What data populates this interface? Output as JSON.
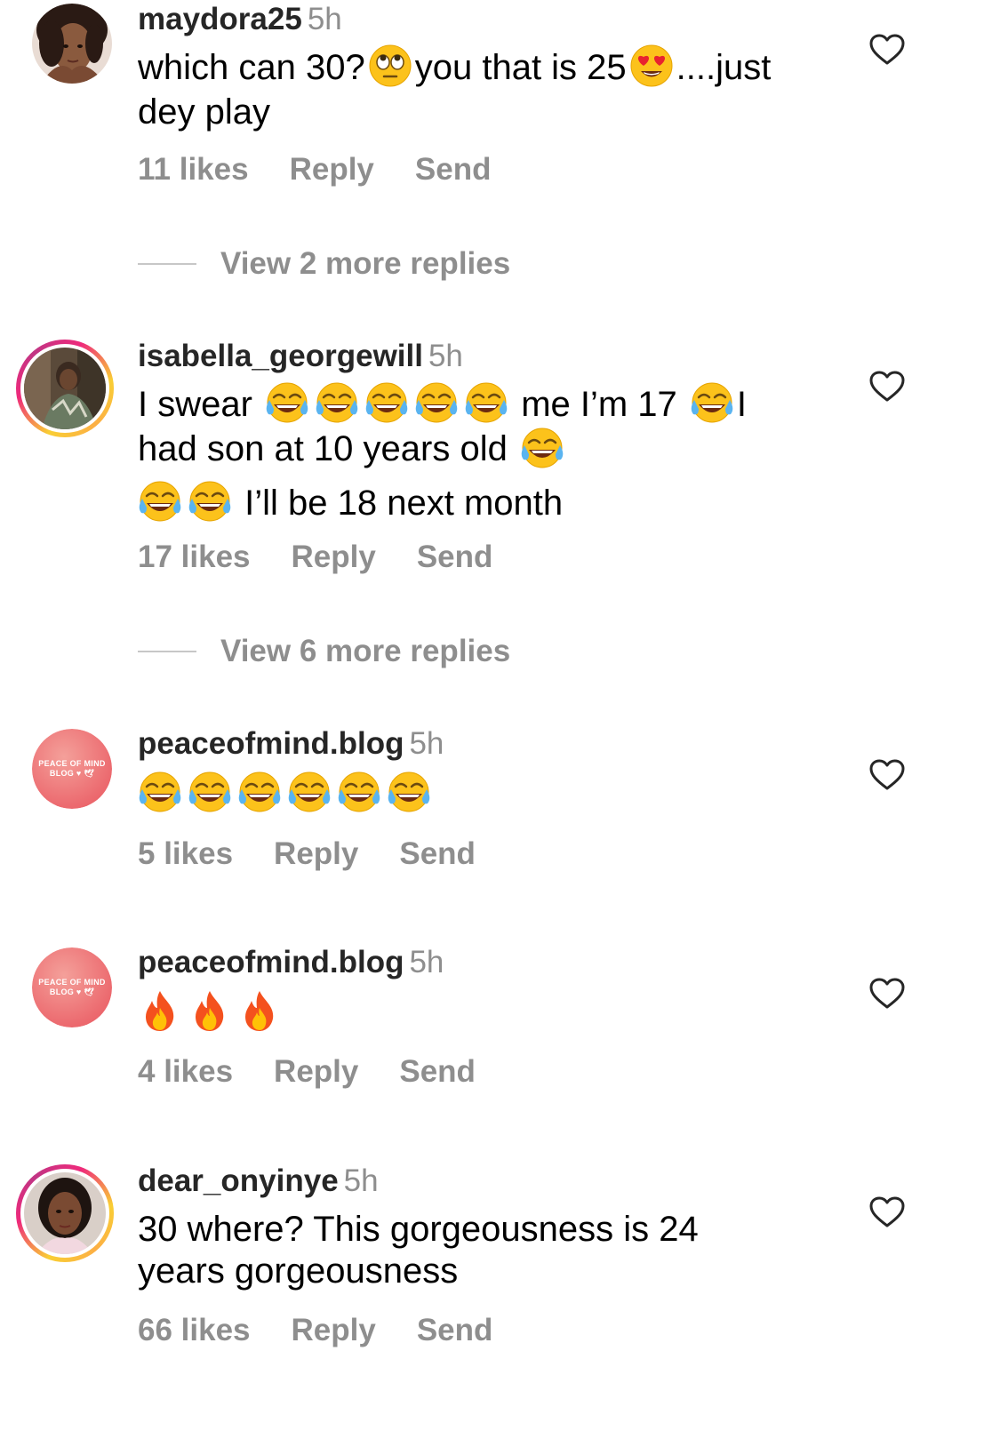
{
  "comments": [
    {
      "username": "maydora25",
      "time": "5h",
      "text_parts": [
        "which can 30?",
        "you that is 25",
        "....just",
        "dey play"
      ],
      "emojis": [
        "rolling-eyes-emoji",
        "heart-eyes-emoji"
      ],
      "likes": "11 likes",
      "reply": "Reply",
      "send": "Send",
      "view_replies": "View 2 more replies"
    },
    {
      "username": "isabella_georgewill",
      "time": "5h",
      "text_parts": [
        "I swear",
        "me I’m 17",
        "I",
        "had son at 10 years old",
        "I’ll be 18 next month"
      ],
      "emojis": [
        "tears-of-joy-emoji"
      ],
      "likes": "17 likes",
      "reply": "Reply",
      "send": "Send",
      "view_replies": "View 6 more replies"
    },
    {
      "username": "peaceofmind.blog",
      "time": "5h",
      "avatar_text": [
        "PEACE OF MIND",
        "BLOG ♥ 🕊"
      ],
      "emojis": [
        "tears-of-joy-emoji"
      ],
      "likes": "5 likes",
      "reply": "Reply",
      "send": "Send"
    },
    {
      "username": "peaceofmind.blog",
      "time": "5h",
      "avatar_text": [
        "PEACE OF MIND",
        "BLOG ♥ 🕊"
      ],
      "emojis": [
        "fire-emoji"
      ],
      "likes": "4 likes",
      "reply": "Reply",
      "send": "Send"
    },
    {
      "username": "dear_onyinye",
      "time": "5h",
      "text_parts": [
        "30 where? This gorgeousness is 24",
        "years gorgeousness"
      ],
      "likes": "66 likes",
      "reply": "Reply",
      "send": "Send"
    }
  ],
  "colors": {
    "username": "#262626",
    "secondary": "#8e8e8e",
    "story_ring": [
      "#f9ce34",
      "#ee2a7b",
      "#c13584"
    ],
    "avatar_blog": "#ec6a6f"
  },
  "icons": [
    "heart-outline-icon"
  ]
}
